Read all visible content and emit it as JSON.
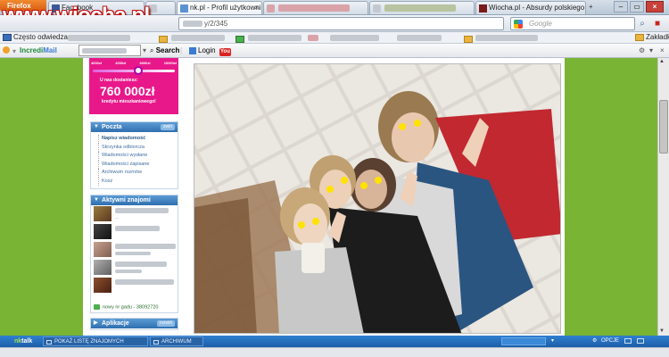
{
  "browser": {
    "app_button": "Firefox",
    "tabs": [
      {
        "label": "Facebook",
        "icon": "facebook-icon",
        "active": false
      },
      {
        "label": "",
        "icon": "blurred-icon",
        "active": false
      },
      {
        "label": "nk.pl - Profil użytkownika !rEw...",
        "icon": "nk-icon",
        "active": true
      },
      {
        "label": "",
        "icon": "blurred-icon",
        "active": false
      },
      {
        "label": "",
        "icon": "blurred-icon",
        "active": false
      },
      {
        "label": "Wiocha.pl - Absurdy polskiego ...",
        "icon": "wiocha-icon",
        "active": false
      }
    ],
    "url_suffix": "y/2/345",
    "search_placeholder": "Google",
    "bookmarks": {
      "most_visited": "Często odwiedzane",
      "right": "Zakładki"
    },
    "toolbar": {
      "incredimail_brand_a": "Incredi",
      "incredimail_brand_b": "Mail",
      "search_label": "Search",
      "login_label": "Login",
      "youtube_label": "You"
    }
  },
  "watermark": "www.wiocha.pl",
  "ad": {
    "ticks": [
      "4000zł",
      "4000zł",
      "8000zł",
      "10000zł"
    ],
    "line1": "U nas dostaniesz:",
    "amount": "760 000zł",
    "line2": "kredytu mieszkaniowego!",
    "slider_fraction": 0.55
  },
  "sidebar": {
    "poczta": {
      "title": "Poczta",
      "more": "zwiń",
      "items": [
        "Napisz wiadomość",
        "Skrzynka odbiorcza",
        "Wiadomości wysłane",
        "Wiadomości zapisane",
        "Archiwum rozmów",
        "Kosz"
      ]
    },
    "znajomi": {
      "title": "Aktywni znajomi",
      "more": "",
      "gadu": "nowy nr gadu - 38092720"
    },
    "aplikacje": {
      "title": "Aplikacje",
      "more": "rozwiń"
    }
  },
  "nktalk": {
    "logo_a": "nk",
    "logo_b": "talk",
    "show_friends": "POKAŻ LISTĘ ZNAJOMYCH",
    "archive": "ARCHIWUM",
    "options": "OPCJE"
  },
  "colors": {
    "page_bg": "#7ab434",
    "accent_blue": "#2f6fb0",
    "ad_pink": "#e8188a"
  }
}
